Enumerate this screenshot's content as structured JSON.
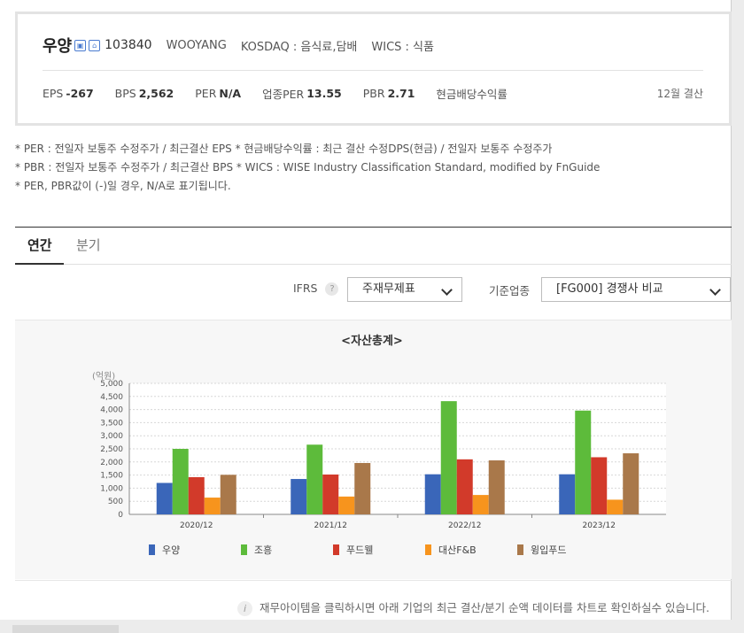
{
  "header": {
    "name": "우양",
    "code": "103840",
    "eng_name": "WOOYANG",
    "market": "KOSDAQ : 음식료,담배",
    "wics": "WICS : 식품",
    "icons": [
      "company-icon",
      "home-icon"
    ],
    "stats": {
      "eps_label": "EPS",
      "eps": "-267",
      "bps_label": "BPS",
      "bps": "2,562",
      "per_label": "PER",
      "per": "N/A",
      "ind_per_label": "업종PER",
      "ind_per": "13.55",
      "pbr_label": "PBR",
      "pbr": "2.71",
      "div_label": "현금배당수익률",
      "settle": "12월 결산"
    }
  },
  "notes": [
    "* PER : 전일자 보통주 수정주가 / 최근결산 EPS * 현금배당수익률 : 최근 결산 수정DPS(현금) / 전일자 보통주 수정주가",
    "* PBR : 전일자 보통주 수정주가 / 최근결산 BPS * WICS : WISE Industry Classification Standard, modified by FnGuide",
    "* PER, PBR값이 (-)일 경우, N/A로 표기됩니다."
  ],
  "tabs": [
    {
      "label": "연간",
      "active": true
    },
    {
      "label": "분기",
      "active": false
    }
  ],
  "controls": {
    "ifrs_label": "IFRS",
    "help": "?",
    "statement_select": "주재무제표",
    "industry_label": "기준업종",
    "industry_select": "[FG000] 경쟁사 비교"
  },
  "chart_title": "<자산총계>",
  "unit_label": "(억원)",
  "chart_data": {
    "type": "bar",
    "categories": [
      "2020/12",
      "2021/12",
      "2022/12",
      "2023/12"
    ],
    "ylim": [
      0,
      5000
    ],
    "yticks": [
      "0",
      "500",
      "1,000",
      "1,500",
      "2,000",
      "2,500",
      "3,000",
      "3,500",
      "4,000",
      "4,500",
      "5,000"
    ],
    "series": [
      {
        "name": "우양",
        "color": "#3a66b9",
        "values": [
          1200,
          1350,
          1530,
          1530
        ]
      },
      {
        "name": "조흥",
        "color": "#5dbb3b",
        "values": [
          2500,
          2660,
          4320,
          3960
        ]
      },
      {
        "name": "푸드웰",
        "color": "#d23a2a",
        "values": [
          1420,
          1520,
          2100,
          2180
        ]
      },
      {
        "name": "대산F&B",
        "color": "#f7941d",
        "values": [
          640,
          680,
          740,
          560
        ]
      },
      {
        "name": "윙입푸드",
        "color": "#a9784a",
        "values": [
          1510,
          1960,
          2060,
          2330
        ]
      }
    ],
    "grid": true,
    "legend": "bottom"
  },
  "info_icon": "i",
  "info_text": "재무아이템을 클릭하시면 아래 기업의 최근 결산/분기 순액 데이터를 차트로 확인하실수 있습니다."
}
